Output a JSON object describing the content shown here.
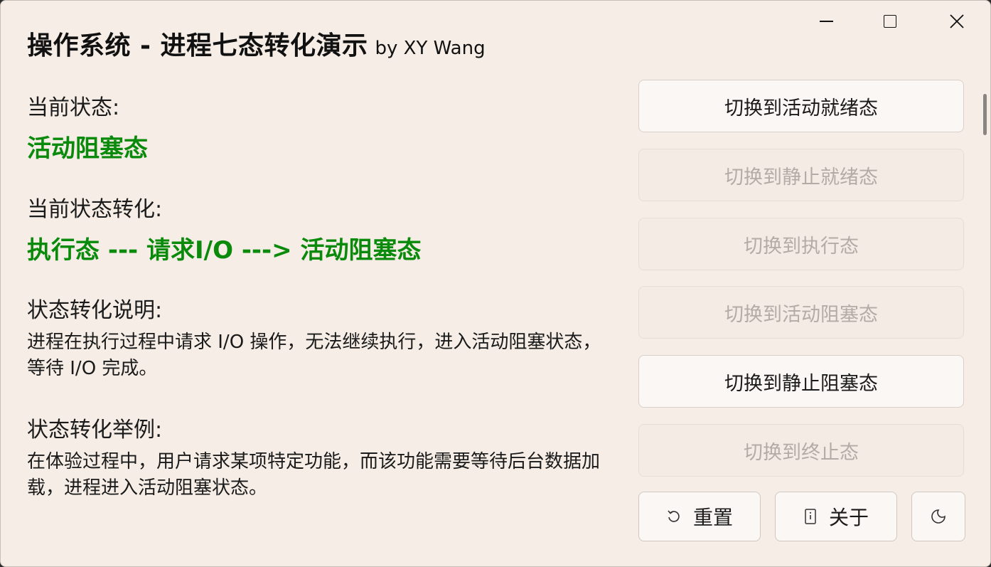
{
  "window": {
    "title": "操作系统 - 进程七态转化演示",
    "subtitle": "by XY Wang"
  },
  "left": {
    "current_state_label": "当前状态:",
    "current_state_value": "活动阻塞态",
    "transition_label": "当前状态转化:",
    "transition_value": "执行态 --- 请求I/O ---> 活动阻塞态",
    "explain_label": "状态转化说明:",
    "explain_text": "进程在执行过程中请求 I/O 操作，无法继续执行，进入活动阻塞状态，等待 I/O 完成。",
    "example_label": "状态转化举例:",
    "example_text": "在体验过程中，用户请求某项特定功能，而该功能需要等待后台数据加载，进程进入活动阻塞状态。"
  },
  "buttons": [
    {
      "label": "切换到活动就绪态",
      "enabled": true
    },
    {
      "label": "切换到静止就绪态",
      "enabled": false
    },
    {
      "label": "切换到执行态",
      "enabled": false
    },
    {
      "label": "切换到活动阻塞态",
      "enabled": false
    },
    {
      "label": "切换到静止阻塞态",
      "enabled": true
    },
    {
      "label": "切换到终止态",
      "enabled": false
    }
  ],
  "bottom": {
    "reset_label": "重置",
    "about_label": "关于",
    "reset_icon": "undo-icon",
    "about_icon": "info-icon",
    "theme_icon": "moon-icon"
  },
  "colors": {
    "accent_green": "#0a8a0a",
    "background": "#f5ede6",
    "disabled_text": "#b3aca6"
  }
}
